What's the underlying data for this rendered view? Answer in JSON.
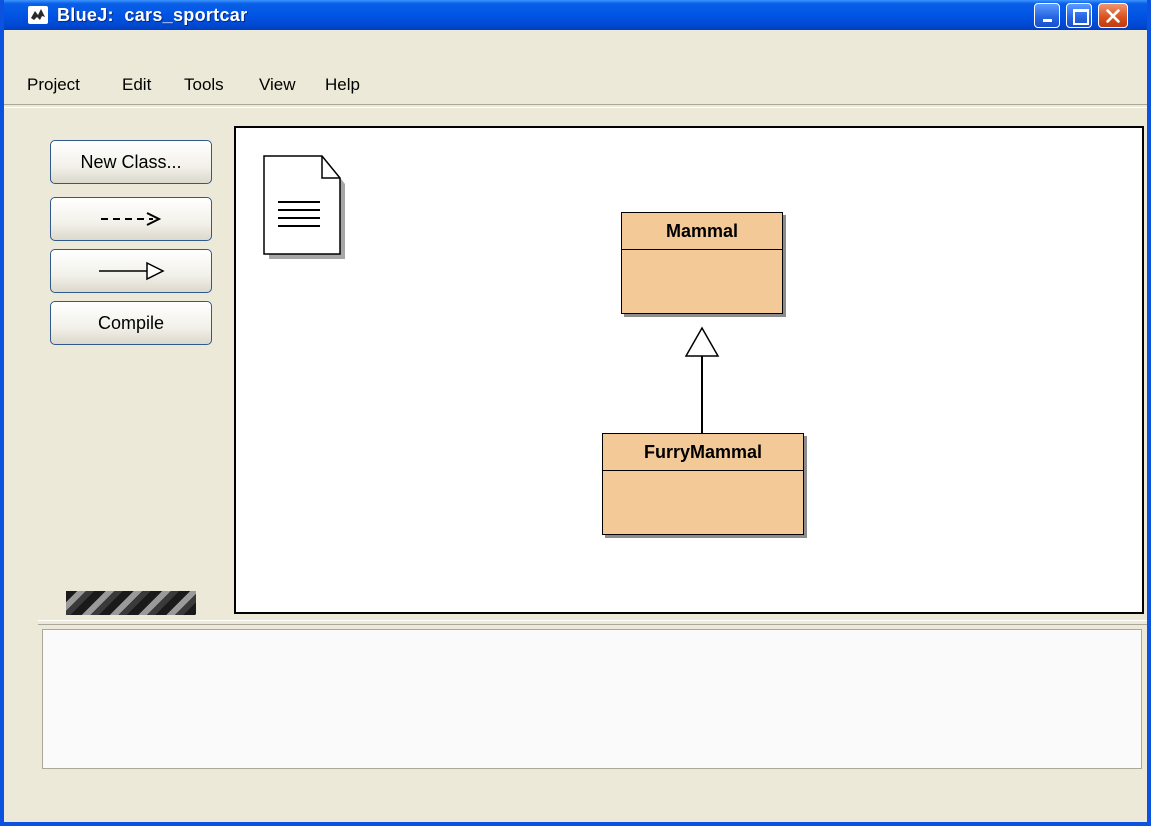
{
  "window": {
    "app_name": "BlueJ:  cars_sportcar",
    "icon": "bluej-bird-icon",
    "controls": [
      "minimize",
      "maximize",
      "close"
    ]
  },
  "menubar": {
    "items": [
      "Project",
      "Edit",
      "Tools",
      "View",
      "Help"
    ]
  },
  "toolbar": {
    "new_class_label": "New Class...",
    "dependency_icon": "dashed-arrow-icon",
    "inheritance_icon": "inheritance-arrow-icon",
    "compile_label": "Compile"
  },
  "diagram": {
    "readme_icon": "readme-document-icon",
    "classes": [
      {
        "name": "Mammal"
      },
      {
        "name": "FurryMammal"
      }
    ],
    "relations": [
      {
        "type": "inheritance",
        "from": "FurryMammal",
        "to": "Mammal"
      }
    ]
  },
  "colors": {
    "titlebar": "#0055e5",
    "class_fill": "#f4c998",
    "window_bg": "#ece9d8"
  }
}
